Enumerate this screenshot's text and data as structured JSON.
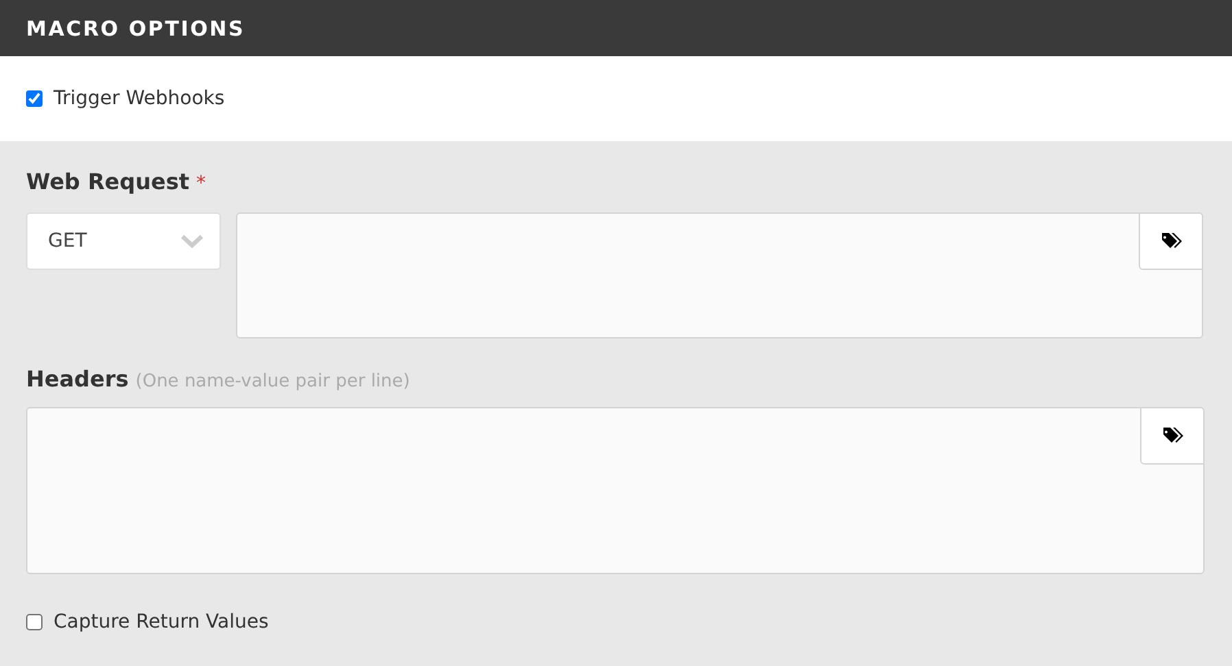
{
  "header": {
    "title": "MACRO OPTIONS"
  },
  "trigger": {
    "label": "Trigger Webhooks",
    "checked": true
  },
  "web_request": {
    "label": "Web Request",
    "required_mark": "*",
    "method": "GET"
  },
  "headers": {
    "label": "Headers",
    "hint": "(One name-value pair per line)"
  },
  "capture": {
    "label": "Capture Return Values",
    "checked": false
  }
}
